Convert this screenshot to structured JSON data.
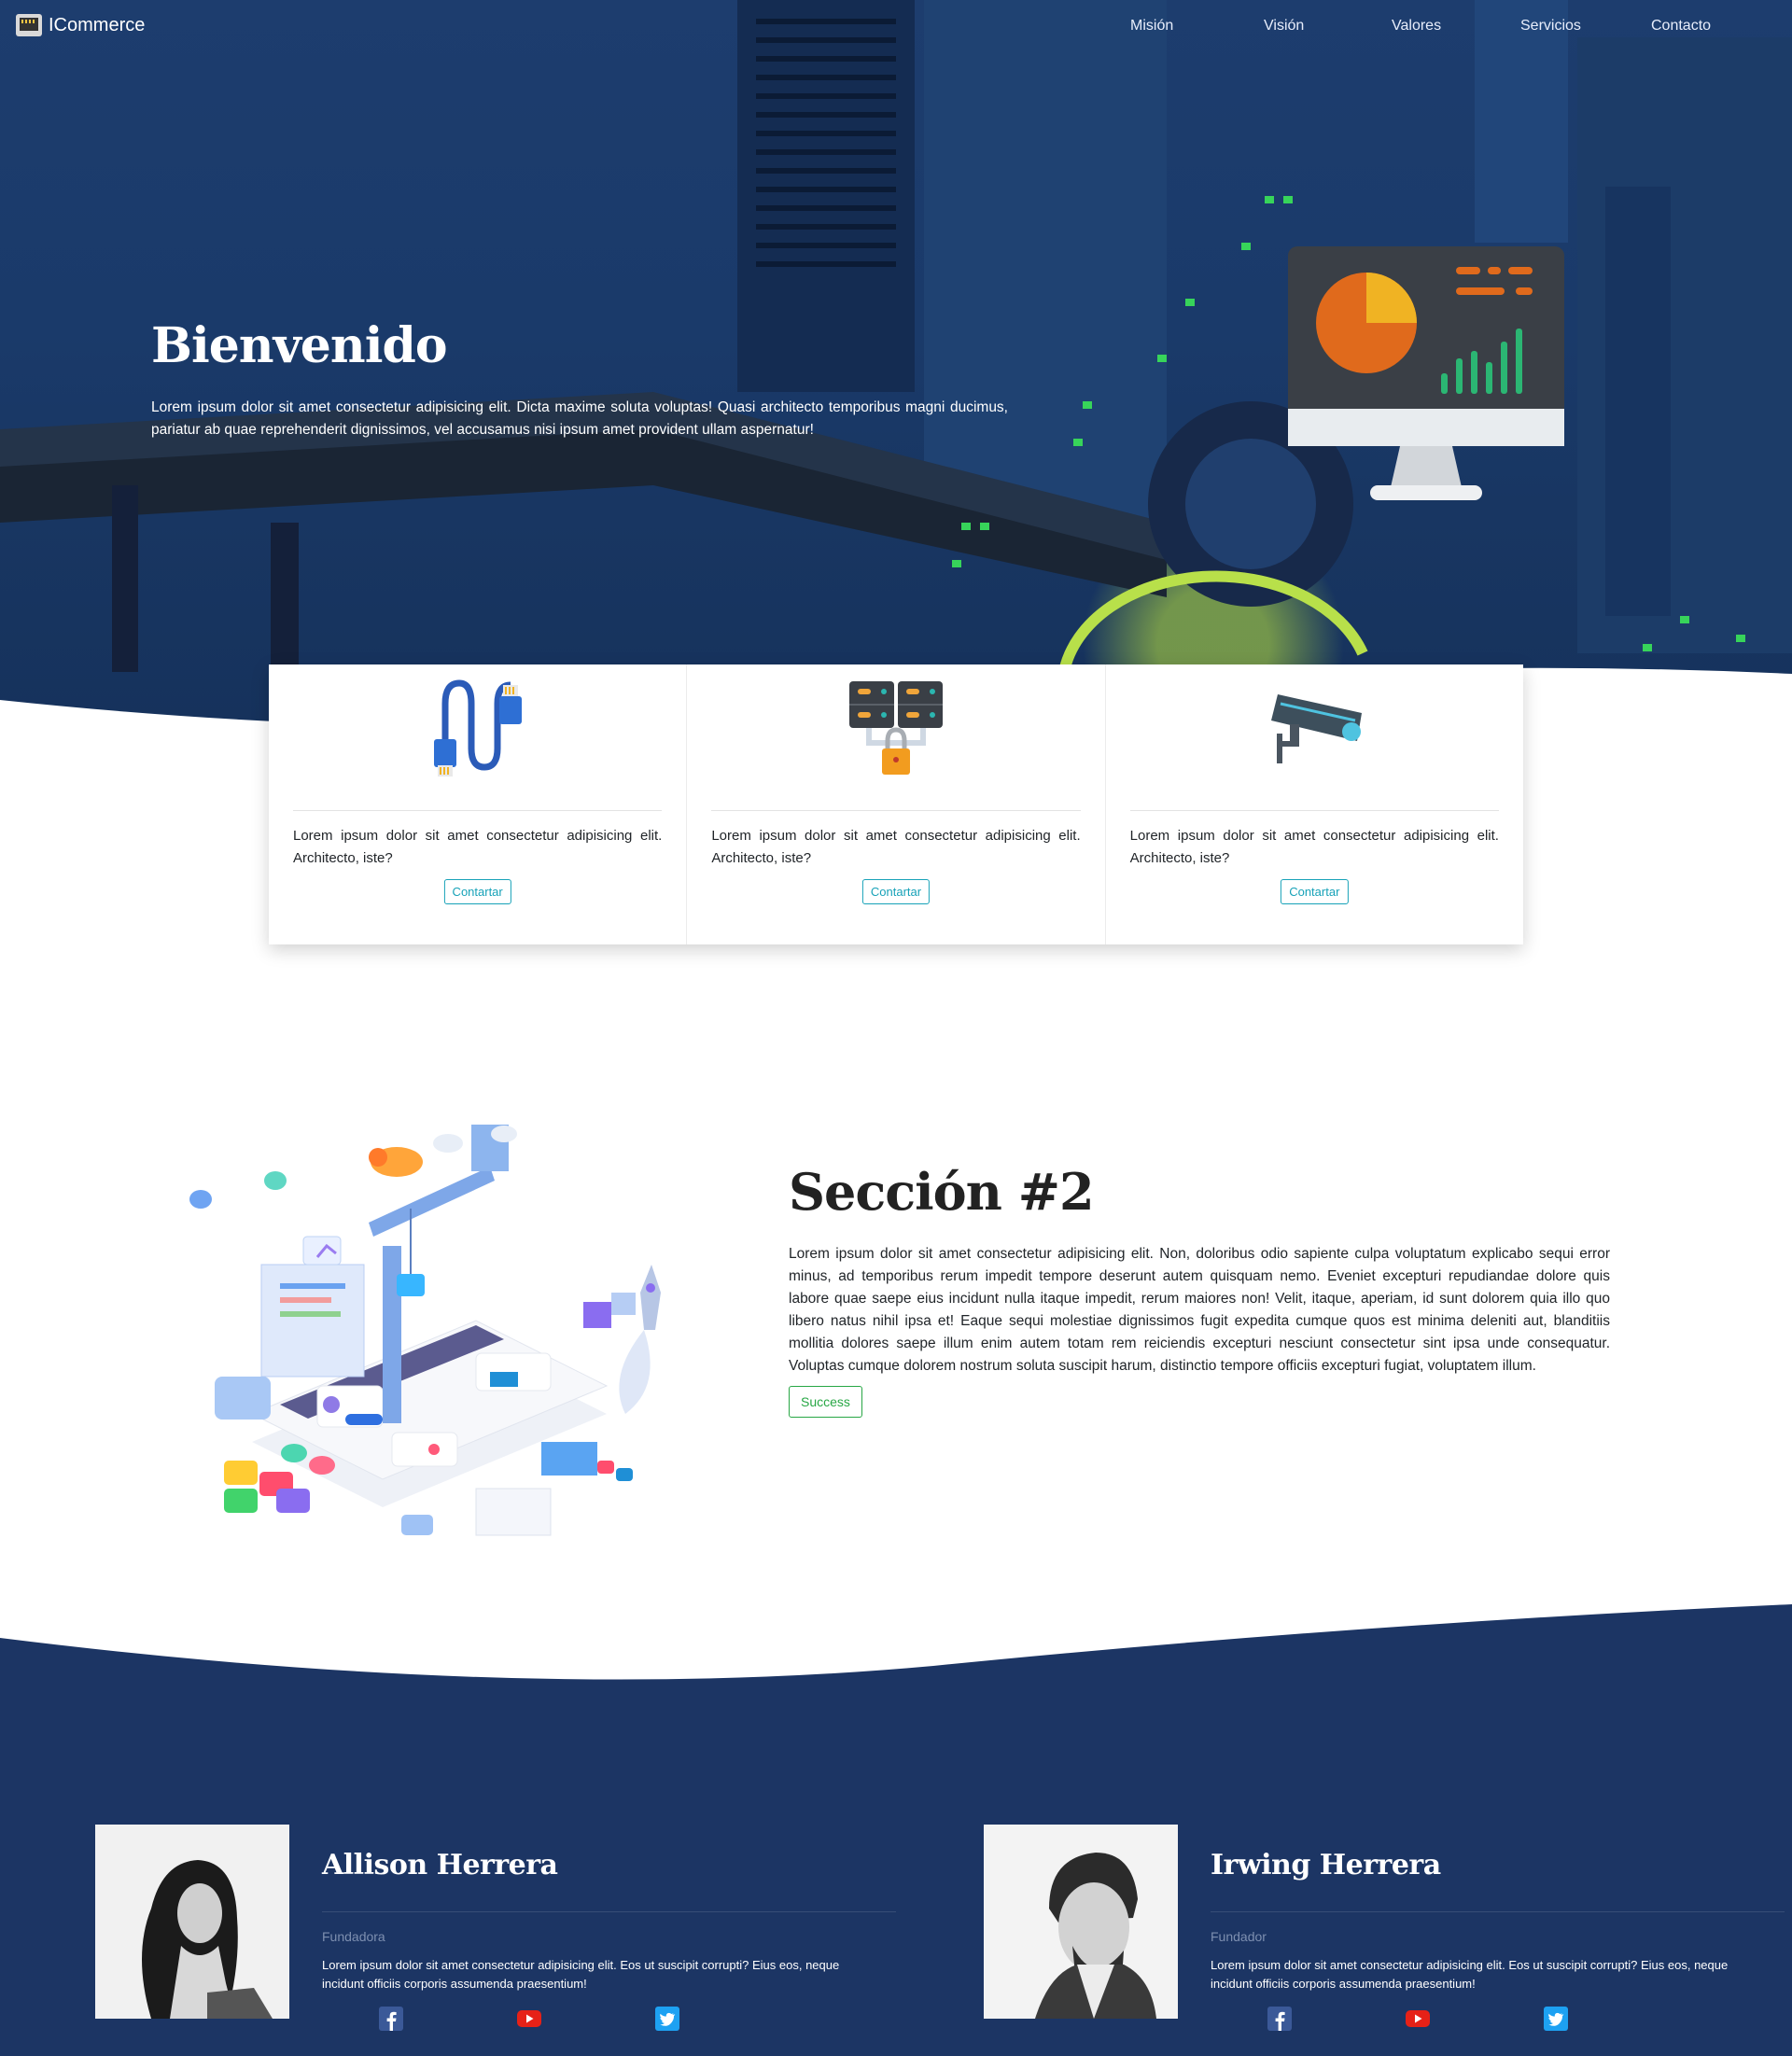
{
  "brand": {
    "name": "ICommerce"
  },
  "nav": {
    "items": [
      "Misión",
      "Visión",
      "Valores",
      "Servicios",
      "Contacto"
    ]
  },
  "hero": {
    "title": "Bienvenido",
    "text": "Lorem ipsum dolor sit amet consectetur adipisicing elit. Dicta maxime soluta voluptas! Quasi architecto temporibus magni ducimus, pariatur ab quae reprehenderit dignissimos, vel accusamus nisi ipsum amet provident ullam aspernatur!"
  },
  "services": [
    {
      "icon": "network-cable-icon",
      "text": "Lorem ipsum dolor sit amet consectetur adipisicing elit. Architecto, iste?",
      "button": "Contartar"
    },
    {
      "icon": "server-lock-icon",
      "text": "Lorem ipsum dolor sit amet consectetur adipisicing elit. Architecto, iste?",
      "button": "Contartar"
    },
    {
      "icon": "security-camera-icon",
      "text": "Lorem ipsum dolor sit amet consectetur adipisicing elit. Architecto, iste?",
      "button": "Contartar"
    }
  ],
  "section2": {
    "title": "Sección #2",
    "text": "Lorem ipsum dolor sit amet consectetur adipisicing elit. Non, doloribus odio sapiente culpa voluptatum explicabo sequi error minus, ad temporibus rerum impedit tempore deserunt autem quisquam nemo. Eveniet excepturi repudiandae dolore quis labore quae saepe eius incidunt nulla itaque impedit, rerum maiores non! Velit, itaque, aperiam, id sunt dolorem quia illo quo libero natus nihil ipsa et! Eaque sequi molestiae dignissimos fugit expedita cumque quos est minima deleniti aut, blanditiis mollitia dolores saepe illum enim autem totam rem reiciendis excepturi nesciunt consectetur sint ipsa unde consequatur. Voluptas cumque dolorem nostrum soluta suscipit harum, distinctio tempore officiis excepturi fugiat, voluptatem illum.",
    "button": "Success"
  },
  "team": [
    {
      "name": "Allison Herrera",
      "role": "Fundadora",
      "text": "Lorem ipsum dolor sit amet consectetur adipisicing elit. Eos ut suscipit corrupti? Eius eos, neque incidunt officiis corporis assumenda praesentium!",
      "socials": [
        "facebook-icon",
        "youtube-icon",
        "twitter-icon"
      ]
    },
    {
      "name": "Irwing Herrera",
      "role": "Fundador",
      "text": "Lorem ipsum dolor sit amet consectetur adipisicing elit. Eos ut suscipit corrupti? Eius eos, neque incidunt officiis corporis assumenda praesentium!",
      "socials": [
        "facebook-icon",
        "youtube-icon",
        "twitter-icon"
      ]
    }
  ],
  "colors": {
    "hero_bg": "#1b3a6b",
    "team_bg": "#1c3564",
    "info": "#17a2b8",
    "success": "#28a745",
    "facebook": "#3b5998",
    "youtube": "#e62117",
    "twitter": "#1da1f2"
  }
}
